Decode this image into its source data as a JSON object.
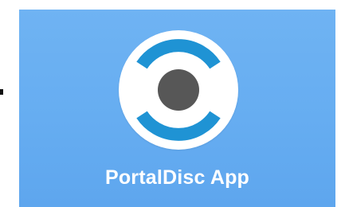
{
  "app": {
    "name": "PortalDisc App",
    "icon": "portaldisc-logo-icon"
  },
  "colors": {
    "tile_background": "#66adf1",
    "logo_disc": "#ffffff",
    "logo_arcs": "#1f93d4",
    "logo_center": "#575757",
    "label_text": "#ffffff"
  }
}
